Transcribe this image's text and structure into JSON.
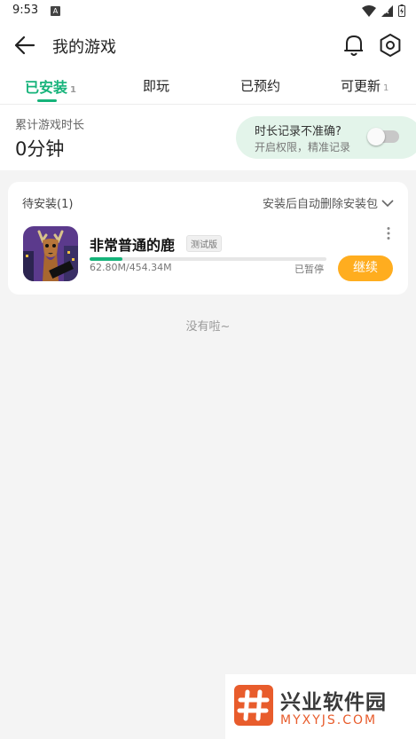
{
  "status_bar": {
    "time": "9:53",
    "notification_badge": "A"
  },
  "header": {
    "title": "我的游戏"
  },
  "tabs": [
    {
      "label": "已安装",
      "count": "1",
      "active": true
    },
    {
      "label": "即玩",
      "count": ""
    },
    {
      "label": "已预约",
      "count": ""
    },
    {
      "label": "可更新",
      "count": "1"
    }
  ],
  "summary": {
    "label": "累计游戏时长",
    "value": "0分钟",
    "tip_title": "时长记录不准确?",
    "tip_subtitle": "开启权限，精准记录",
    "toggle_on": false
  },
  "pending": {
    "title": "待安装(1)",
    "auto_delete_label": "安装后自动删除安装包",
    "game": {
      "name": "非常普通的鹿",
      "badge": "测试版",
      "progress_text": "62.80M/454.34M",
      "progress_fraction": 0.138,
      "status": "已暂停",
      "button_label": "继续"
    }
  },
  "empty_text": "没有啦~",
  "watermark": {
    "title": "兴业软件园",
    "subtitle": "MYXYJS.COM"
  },
  "colors": {
    "accent": "#16b37a",
    "continue_button": "#ffad1f",
    "tip_bg": "#e3f4ea"
  }
}
